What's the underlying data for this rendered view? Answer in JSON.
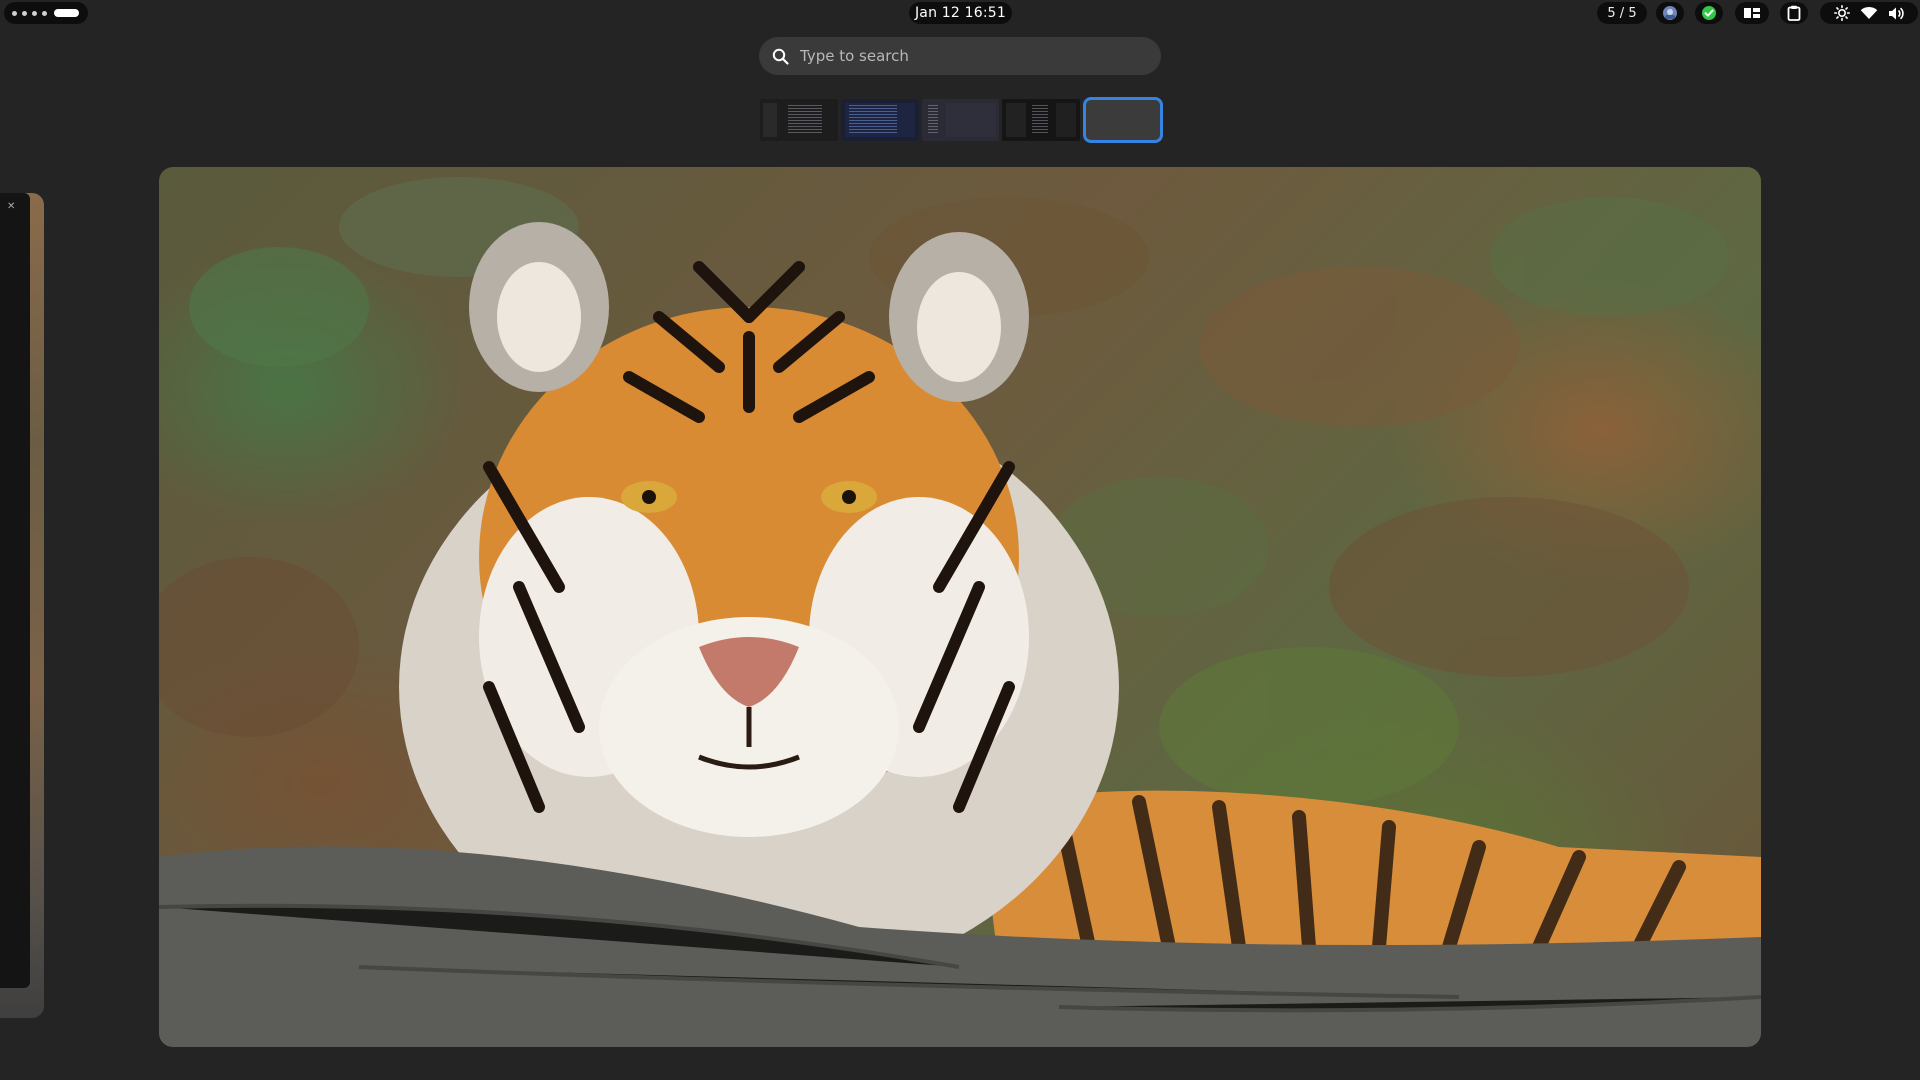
{
  "topbar": {
    "clock": "Jan 12  16:51",
    "window_counter": "5 / 5"
  },
  "search": {
    "placeholder": "Type to search"
  },
  "colors": {
    "accent": "#3584e4",
    "panel": "#0d0d0d",
    "background": "#242424",
    "tray_green": "#33c748"
  },
  "icons": {
    "search": "search-icon",
    "tray": [
      "app-indicator-icon",
      "check-status-icon",
      "layout-icon",
      "clipboard-icon"
    ],
    "system": [
      "brightness-icon",
      "wifi-icon",
      "volume-icon"
    ]
  }
}
